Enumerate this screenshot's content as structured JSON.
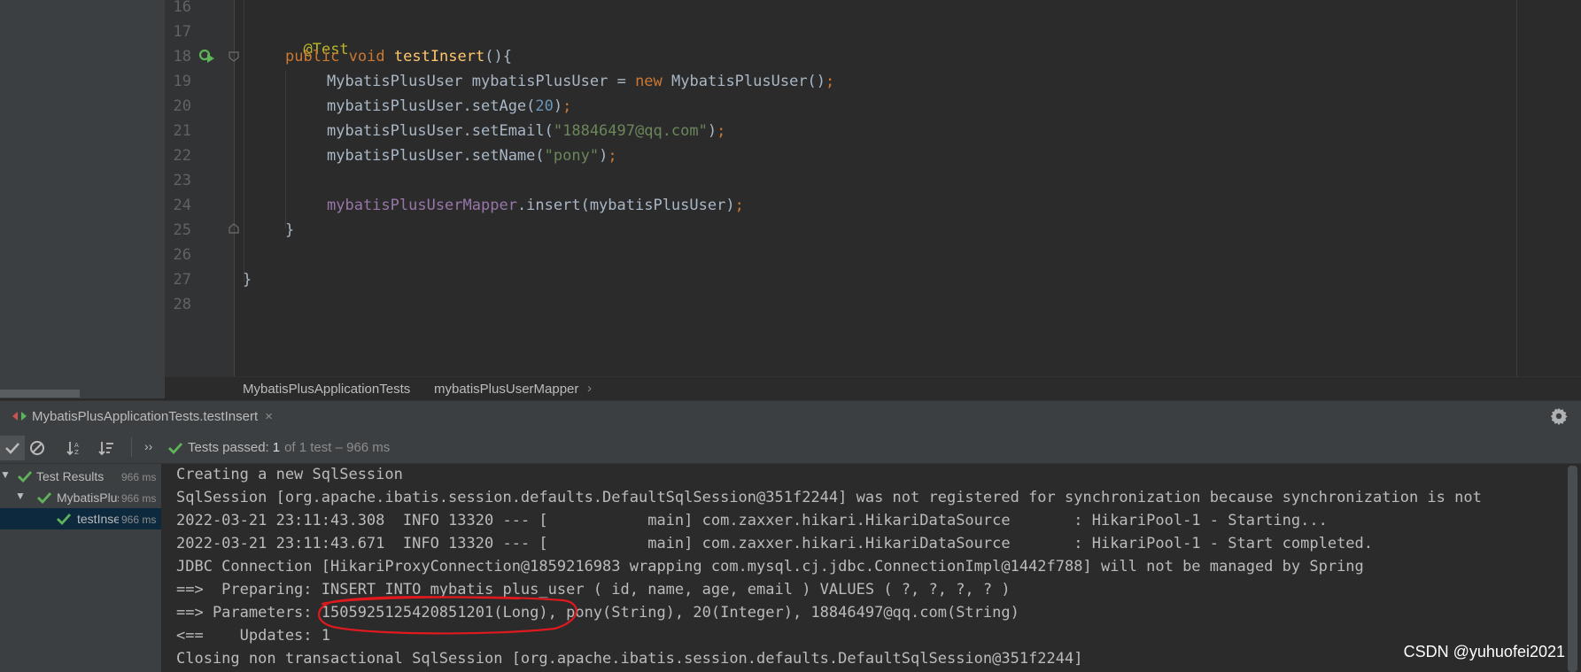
{
  "editor": {
    "line_numbers": [
      "16",
      "17",
      "18",
      "19",
      "20",
      "21",
      "22",
      "23",
      "24",
      "25",
      "26",
      "27",
      "28"
    ],
    "code": {
      "annotation": "@Test",
      "kw_public": "public",
      "kw_void": "void",
      "method_name": "testInsert",
      "method_paren": "(){",
      "type_name": "MybatisPlusUser",
      "var_name": "mybatisPlusUser",
      "assign": "=",
      "kw_new": "new",
      "ctor_call": "MybatisPlusUser()",
      "semi": ";",
      "set_age_call": "mybatisPlusUser.setAge(",
      "age_value": "20",
      "close_paren": ")",
      "set_email_call": "mybatisPlusUser.setEmail(",
      "email_value": "\"18846497@qq.com\"",
      "set_name_call": "mybatisPlusUser.setName(",
      "name_value": "\"pony\"",
      "mapper_field": "mybatisPlusUserMapper",
      "insert_call": ".insert(mybatisPlusUser)",
      "close_method": "}",
      "close_class": "}"
    }
  },
  "breadcrumb": {
    "class_name": "MybatisPlusApplicationTests",
    "separator": "›",
    "member_name": "mybatisPlusUserMapper"
  },
  "run_window": {
    "tab_title": "MybatisPlusApplicationTests.testInsert",
    "tab_close": "×",
    "status_passed": "Tests passed:",
    "status_count": "1",
    "status_detail": "of 1 test – 966 ms",
    "more_label": "››"
  },
  "test_tree": [
    {
      "label": "Test Results",
      "time": "966 ms"
    },
    {
      "label": "MybatisPlusApplicationTests",
      "time": "966 ms"
    },
    {
      "label": "testInsert",
      "time": "966 ms"
    }
  ],
  "console": [
    "Creating a new SqlSession",
    "SqlSession [org.apache.ibatis.session.defaults.DefaultSqlSession@351f2244] was not registered for synchronization because synchronization is not",
    "2022-03-21 23:11:43.308  INFO 13320 --- [           main] com.zaxxer.hikari.HikariDataSource       : HikariPool-1 - Starting...",
    "2022-03-21 23:11:43.671  INFO 13320 --- [           main] com.zaxxer.hikari.HikariDataSource       : HikariPool-1 - Start completed.",
    "JDBC Connection [HikariProxyConnection@1859216983 wrapping com.mysql.cj.jdbc.ConnectionImpl@1442f788] will not be managed by Spring",
    "==>  Preparing: INSERT INTO mybatis_plus_user ( id, name, age, email ) VALUES ( ?, ?, ?, ? )",
    "==> Parameters: 1505925125420851201(Long), pony(String), 20(Integer), 18846497@qq.com(String)",
    "<==    Updates: 1",
    "Closing non transactional SqlSession [org.apache.ibatis.session.defaults.DefaultSqlSession@351f2244]"
  ],
  "watermark": "CSDN @yuhuofei2021",
  "colors": {
    "editor_bg": "#2b2b2b",
    "panel_bg": "#3c3f41",
    "pass_green": "#5fb359",
    "circle_red": "#e0191f"
  }
}
